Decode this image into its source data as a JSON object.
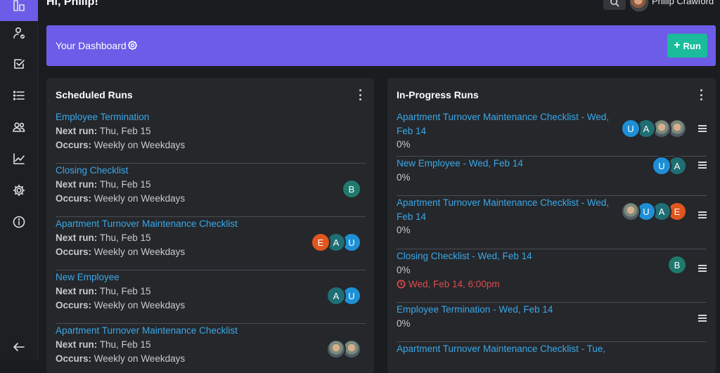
{
  "header": {
    "greeting": "Hi, Philip!",
    "user_name": "Philip Crawford"
  },
  "sidebar": {
    "items": [
      {
        "icon": "dashboard-icon",
        "active": true
      },
      {
        "icon": "user-check-icon"
      },
      {
        "icon": "checkbox-icon"
      },
      {
        "icon": "list-icon"
      },
      {
        "icon": "users-icon"
      },
      {
        "icon": "chart-line-icon"
      },
      {
        "icon": "gear-icon"
      },
      {
        "icon": "info-icon"
      },
      {
        "icon": "arrow-left-icon"
      }
    ]
  },
  "banner": {
    "title": "Your Dashboard",
    "run_label": "Run",
    "run_plus": "+"
  },
  "colors": {
    "accent": "#6c5ce7",
    "run_button": "#1abc9c",
    "link": "#3aa8e8",
    "overdue": "#e04b4b"
  },
  "scheduled": {
    "title": "Scheduled Runs",
    "next_label": "Next run:",
    "occurs_label": "Occurs:",
    "rows": [
      {
        "name": "Employee Termination",
        "next": "Thu, Feb 15",
        "occurs": "Weekly on Weekdays",
        "avatars": []
      },
      {
        "name": "Closing Checklist",
        "next": "Thu, Feb 15",
        "occurs": "Weekly on Weekdays",
        "avatars": [
          {
            "letter": "B",
            "color": "#1f7a6d"
          }
        ]
      },
      {
        "name": "Apartment Turnover Maintenance Checklist",
        "next": "Thu, Feb 15",
        "occurs": "Weekly on Weekdays",
        "avatars": [
          {
            "letter": "E",
            "color": "#e0561f"
          },
          {
            "letter": "A",
            "color": "#1f6e73"
          },
          {
            "letter": "U",
            "color": "#1e8fd6"
          }
        ]
      },
      {
        "name": "New Employee",
        "next": "Thu, Feb 15",
        "occurs": "Weekly on Weekdays",
        "avatars": [
          {
            "letter": "A",
            "color": "#1f6e73"
          },
          {
            "letter": "U",
            "color": "#1e8fd6"
          }
        ]
      },
      {
        "name": "Apartment Turnover Maintenance Checklist",
        "next": "Thu, Feb 15",
        "occurs": "Weekly on Weekdays",
        "avatars": [
          {
            "letter": "",
            "photo": true
          },
          {
            "letter": "",
            "photo": true
          }
        ]
      }
    ]
  },
  "in_progress": {
    "title": "In-Progress Runs",
    "rows": [
      {
        "name": "Apartment Turnover Maintenance Checklist - Wed, Feb 14",
        "progress": "0%",
        "due": "",
        "avatars": [
          {
            "letter": "U",
            "color": "#1e8fd6"
          },
          {
            "letter": "A",
            "color": "#1f6e73"
          },
          {
            "letter": "",
            "photo": true
          },
          {
            "letter": "",
            "photo": true
          }
        ]
      },
      {
        "name": "New Employee - Wed, Feb 14",
        "progress": "0%",
        "due": "",
        "avatars": [
          {
            "letter": "U",
            "color": "#1e8fd6"
          },
          {
            "letter": "A",
            "color": "#1f6e73"
          }
        ]
      },
      {
        "name": "Apartment Turnover Maintenance Checklist - Wed, Feb 14",
        "progress": "0%",
        "due": "",
        "avatars": [
          {
            "letter": "",
            "photo": true
          },
          {
            "letter": "U",
            "color": "#1e8fd6"
          },
          {
            "letter": "A",
            "color": "#1f6e73"
          },
          {
            "letter": "E",
            "color": "#e0561f"
          }
        ]
      },
      {
        "name": "Closing Checklist - Wed, Feb 14",
        "progress": "0%",
        "due": "Wed, Feb 14, 6:00pm",
        "avatars": [
          {
            "letter": "B",
            "color": "#1f7a6d"
          }
        ]
      },
      {
        "name": "Employee Termination - Wed, Feb 14",
        "progress": "0%",
        "due": "",
        "avatars": []
      },
      {
        "name": "Apartment Turnover Maintenance Checklist - Tue,",
        "progress": "",
        "due": "",
        "avatars": []
      }
    ]
  }
}
